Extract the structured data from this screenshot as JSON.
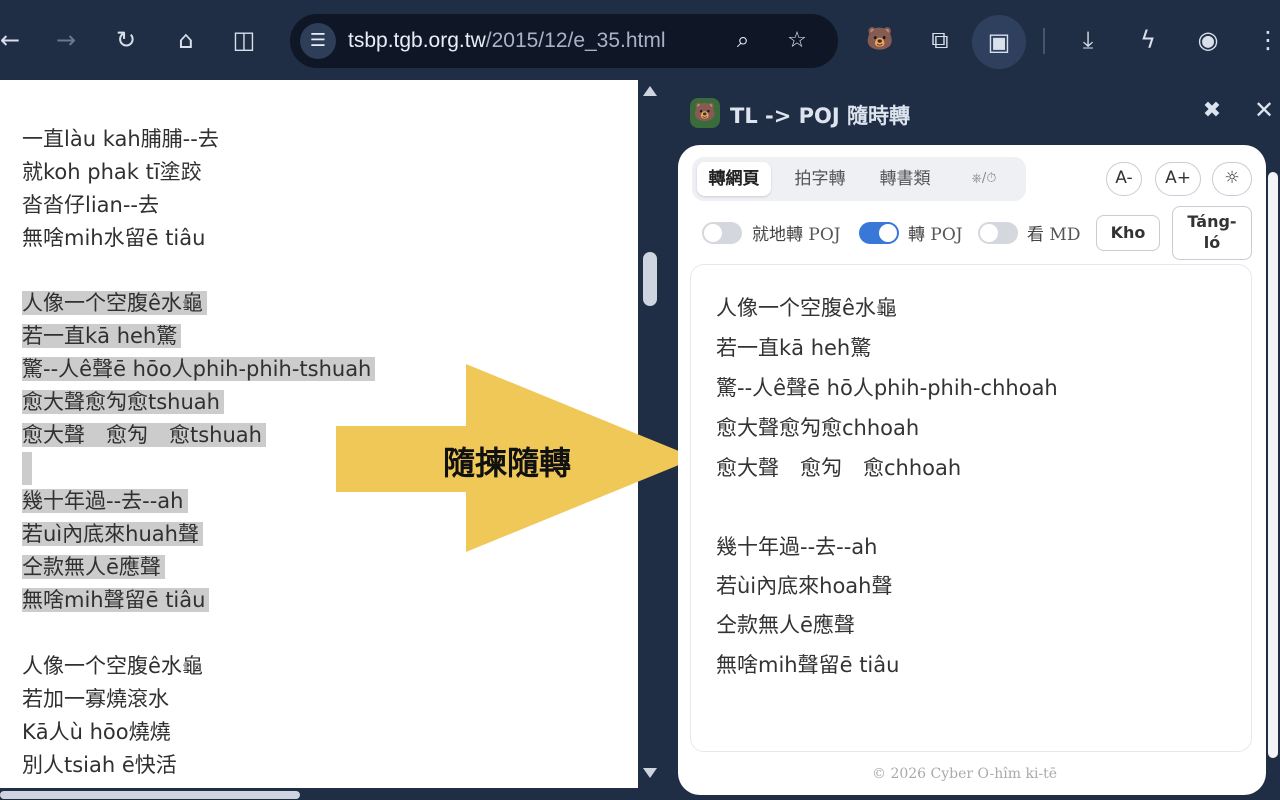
{
  "browser": {
    "url_domain": "tsbp.tgb.org.tw",
    "url_path": "/2015/12/e_35.html"
  },
  "webpage": {
    "lines": [
      "一直làu kah脯脯--去",
      "就koh phak tī塗跤",
      "沓沓仔lian--去",
      "無啥mih水留ē tiâu",
      "人像一个空腹ê水龜",
      "若一直kā heh驚",
      "驚--人ê聲ē hōo人phih-phih-tshuah",
      "愈大聲愈勼愈tshuah",
      "愈大聲　愈勼　愈tshuah",
      "幾十年過--去--ah",
      "若uì內底來huah聲",
      "仝款無人ē應聲",
      "無啥mih聲留ē tiâu",
      "人像一个空腹ê水龜",
      "若加一寡燒滾水",
      "Kā人ù hōo燒燒",
      "別人tsiah ē快活"
    ]
  },
  "arrow_label": "隨揀隨轉",
  "panel": {
    "title": "TL -> POJ 隨時轉",
    "tabs": [
      "轉網頁",
      "拍字轉",
      "轉書類",
      "⎈/⏱"
    ],
    "font_smaller": "A-",
    "font_larger": "A+",
    "toggles": [
      {
        "label_cjk": "就地轉",
        "label_latin": "POJ",
        "on": false
      },
      {
        "label_cjk": "轉",
        "label_latin": "POJ",
        "on": true
      },
      {
        "label_cjk": "看",
        "label_latin": "MD",
        "on": false
      }
    ],
    "copy_button": "Kho",
    "clear_button_line1": "Táng-",
    "clear_button_line2": "ló",
    "content_lines": [
      "人像一个空腹ê水龜",
      "若一直kā heh驚",
      "驚--人ê聲ē hō人phih-phih-chhoah",
      "愈大聲愈勼愈chhoah",
      "愈大聲　愈勼　愈chhoah",
      "幾十年過--去--ah",
      "若ùi內底來hoah聲",
      "仝款無人ē應聲",
      "無啥mih聲留ē tiâu"
    ],
    "footer": "© 2026 Cyber O-hîm ki-tē"
  },
  "colors": {
    "browser_chrome": "#1f2d45",
    "arrow": "#f0c858",
    "toggle_on": "#3a78d8",
    "highlight": "#cccccc"
  }
}
